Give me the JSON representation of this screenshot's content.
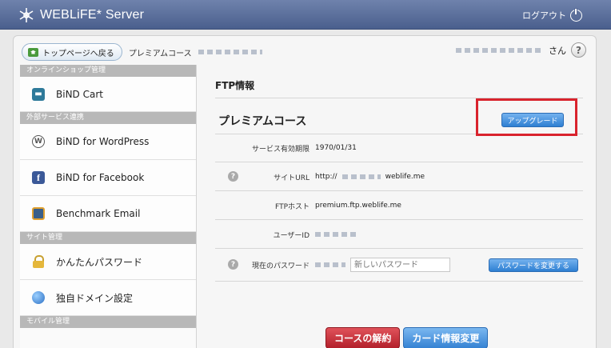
{
  "header": {
    "app_title": "WEBLiFE* Server",
    "logout_label": "ログアウト"
  },
  "breadcrumb": {
    "home_label": "トップページへ戻る",
    "current_label": "プレミアムコース"
  },
  "user": {
    "suffix": "さん",
    "help_label": "?"
  },
  "sidebar": {
    "sections": [
      {
        "title": "オンラインショップ管理",
        "items": [
          {
            "label": "BiND Cart",
            "icon": "cart-icon"
          }
        ]
      },
      {
        "title": "外部サービス連携",
        "items": [
          {
            "label": "BiND for WordPress",
            "icon": "wordpress-icon"
          },
          {
            "label": "BiND for Facebook",
            "icon": "facebook-icon"
          },
          {
            "label": "Benchmark Email",
            "icon": "benchmark-icon"
          }
        ]
      },
      {
        "title": "サイト管理",
        "items": [
          {
            "label": "かんたんパスワード",
            "icon": "lock-icon"
          },
          {
            "label": "独自ドメイン設定",
            "icon": "globe-icon"
          }
        ]
      },
      {
        "title": "モバイル管理",
        "items": []
      }
    ]
  },
  "main": {
    "section_title": "FTP情報",
    "plan_title": "プレミアムコース",
    "upgrade_label": "アップグレード",
    "rows": {
      "expiry": {
        "label": "サービス有効期限",
        "value": "1970/01/31"
      },
      "site_url": {
        "label": "サイトURL",
        "prefix": "http://",
        "suffix": "weblife.me"
      },
      "ftp_host": {
        "label": "FTPホスト",
        "value": "premium.ftp.weblife.me"
      },
      "user_id": {
        "label": "ユーザーID"
      },
      "password": {
        "label": "現在のパスワード",
        "placeholder": "新しいパスワード",
        "button": "パスワードを変更する"
      }
    },
    "cancel_label": "コースの解約",
    "card_label": "カード情報変更"
  },
  "colors": {
    "header_bg": "#5a6e9a",
    "primary_blue": "#3582d3",
    "danger_red": "#b3202b",
    "highlight_red": "#d9232d"
  }
}
